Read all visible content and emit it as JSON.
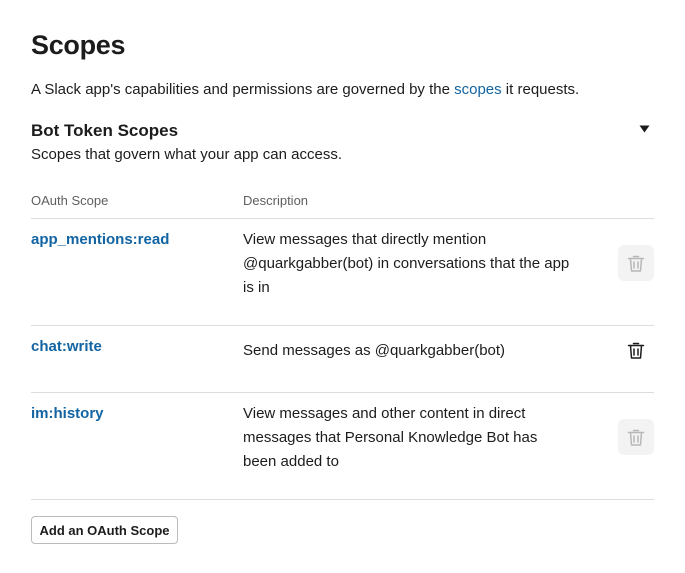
{
  "header": {
    "title": "Scopes",
    "intro_before": "A Slack app's capabilities and permissions are governed by the ",
    "intro_link": "scopes",
    "intro_after": " it requests."
  },
  "bot_scopes": {
    "title": "Bot Token Scopes",
    "subtitle": "Scopes that govern what your app can access.",
    "toggle_icon": "caret-down-icon",
    "columns": {
      "scope": "OAuth Scope",
      "description": "Description"
    },
    "rows": [
      {
        "scope": "app_mentions:read",
        "description": "View messages that directly mention @quarkgabber(bot) in conversations that the app is in",
        "delete_enabled": false
      },
      {
        "scope": "chat:write",
        "description": "Send messages as @quarkgabber(bot)",
        "delete_enabled": true
      },
      {
        "scope": "im:history",
        "description": "View messages and other content in direct messages that Personal Knowledge Bot has been added to",
        "delete_enabled": false
      }
    ],
    "delete_icon": "trash-icon",
    "add_button": "Add an OAuth Scope"
  },
  "colors": {
    "link": "#1264a3",
    "text": "#1d1c1d",
    "muted": "#616061",
    "divider": "#dddddd",
    "disabled_icon": "#b8b8b8"
  }
}
